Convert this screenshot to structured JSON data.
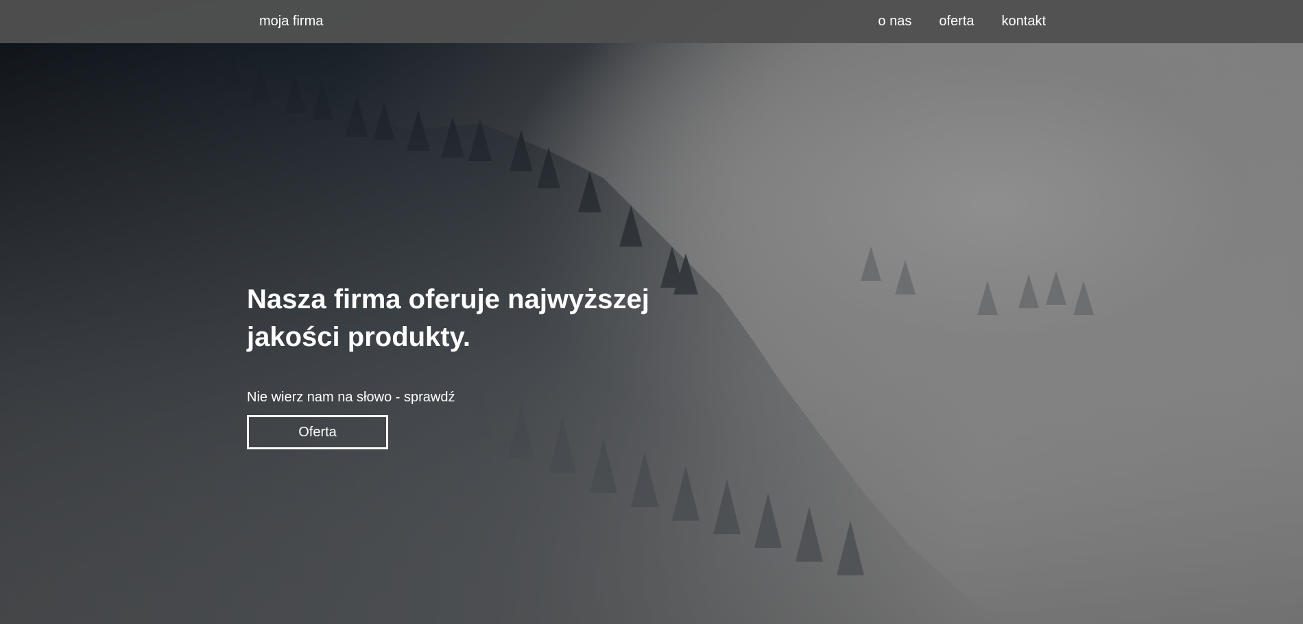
{
  "header": {
    "brand": "moja firma",
    "nav": [
      {
        "label": "o nas"
      },
      {
        "label": "oferta"
      },
      {
        "label": "kontakt"
      }
    ]
  },
  "hero": {
    "title": "Nasza firma oferuje najwyższej jakości produkty.",
    "subtitle": "Nie wierz nam na słowo - sprawdź",
    "cta_label": "Oferta",
    "background_image": "foggy-forest-hillside"
  },
  "colors": {
    "header_bg": "#505050",
    "text": "#ffffff",
    "accent_border": "#ffffff"
  }
}
